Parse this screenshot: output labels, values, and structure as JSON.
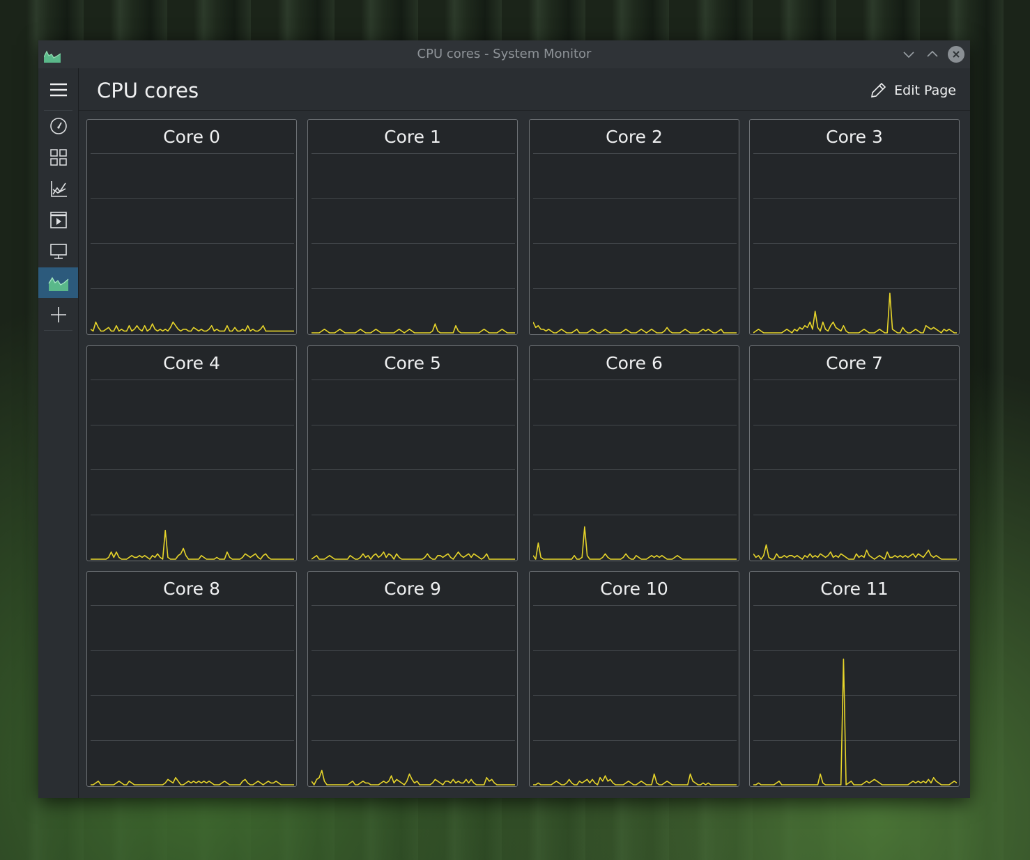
{
  "window": {
    "title": "CPU cores - System Monitor",
    "app_icon": "system-monitor-icon"
  },
  "page": {
    "title": "CPU cores",
    "edit_label": "Edit Page"
  },
  "sidebar": {
    "items": [
      {
        "icon": "hamburger-menu-icon"
      },
      {
        "icon": "speedometer-icon"
      },
      {
        "icon": "applications-grid-icon"
      },
      {
        "icon": "history-chart-icon"
      },
      {
        "icon": "processes-icon"
      },
      {
        "icon": "display-icon"
      },
      {
        "icon": "cpu-cores-icon",
        "active": true
      },
      {
        "icon": "add-page-icon"
      }
    ]
  },
  "colors": {
    "accent": "#2c5a7c",
    "line": "#e7d52a",
    "card_bg": "#232629",
    "window_bg": "#2a2e32"
  },
  "chart_data": {
    "type": "line",
    "ylim": [
      0,
      100
    ],
    "grid": true,
    "series": [
      {
        "name": "Core 0",
        "values": [
          2,
          1,
          6,
          3,
          1,
          1,
          2,
          3,
          1,
          1,
          4,
          1,
          2,
          1,
          1,
          4,
          1,
          2,
          4,
          2,
          1,
          4,
          1,
          2,
          5,
          2,
          1,
          2,
          1,
          2,
          1,
          3,
          6,
          4,
          2,
          1,
          2,
          2,
          1,
          1,
          3,
          2,
          1,
          2,
          1,
          1,
          2,
          4,
          1,
          2,
          1,
          1,
          1,
          4,
          1,
          1,
          3,
          1,
          1,
          2,
          1,
          4,
          1,
          2,
          1,
          1,
          2,
          4,
          1,
          1,
          1,
          1,
          1,
          1,
          1,
          1,
          1,
          1,
          1,
          1
        ]
      },
      {
        "name": "Core 1",
        "values": [
          0,
          0,
          0,
          0,
          1,
          2,
          1,
          0,
          0,
          0,
          1,
          2,
          1,
          0,
          0,
          0,
          0,
          0,
          1,
          2,
          1,
          0,
          0,
          0,
          1,
          2,
          1,
          0,
          0,
          0,
          0,
          0,
          0,
          1,
          2,
          1,
          0,
          1,
          2,
          1,
          0,
          0,
          0,
          0,
          0,
          0,
          0,
          1,
          5,
          1,
          0,
          0,
          0,
          0,
          0,
          0,
          4,
          1,
          0,
          0,
          0,
          0,
          0,
          0,
          0,
          0,
          1,
          2,
          1,
          0,
          0,
          0,
          0,
          1,
          2,
          1,
          0,
          0,
          0,
          0
        ]
      },
      {
        "name": "Core 2",
        "values": [
          6,
          3,
          4,
          2,
          2,
          1,
          2,
          1,
          0,
          0,
          1,
          2,
          1,
          0,
          0,
          0,
          1,
          2,
          0,
          0,
          0,
          0,
          1,
          2,
          1,
          0,
          0,
          1,
          2,
          1,
          0,
          0,
          0,
          0,
          0,
          1,
          2,
          1,
          0,
          0,
          0,
          1,
          2,
          1,
          0,
          1,
          2,
          1,
          0,
          0,
          0,
          1,
          3,
          1,
          0,
          0,
          0,
          0,
          1,
          2,
          1,
          0,
          0,
          0,
          0,
          1,
          2,
          1,
          2,
          1,
          0,
          0,
          1,
          2,
          0,
          0,
          0,
          0,
          0,
          0
        ]
      },
      {
        "name": "Core 3",
        "values": [
          0,
          1,
          2,
          1,
          0,
          0,
          0,
          0,
          0,
          0,
          0,
          0,
          1,
          2,
          1,
          0,
          2,
          1,
          3,
          2,
          4,
          3,
          6,
          2,
          12,
          3,
          1,
          6,
          2,
          1,
          4,
          6,
          3,
          2,
          1,
          4,
          1,
          0,
          0,
          0,
          0,
          0,
          1,
          2,
          1,
          0,
          0,
          0,
          1,
          2,
          1,
          0,
          0,
          22,
          2,
          1,
          0,
          0,
          3,
          1,
          0,
          0,
          1,
          2,
          1,
          0,
          0,
          4,
          3,
          2,
          3,
          2,
          1,
          0,
          2,
          1,
          2,
          1,
          0,
          0
        ]
      },
      {
        "name": "Core 4",
        "values": [
          0,
          0,
          0,
          0,
          0,
          0,
          0,
          1,
          4,
          1,
          4,
          1,
          0,
          0,
          0,
          1,
          2,
          1,
          1,
          2,
          1,
          2,
          1,
          0,
          2,
          1,
          3,
          1,
          0,
          16,
          1,
          0,
          0,
          0,
          2,
          3,
          6,
          2,
          0,
          0,
          0,
          0,
          0,
          2,
          1,
          0,
          0,
          0,
          0,
          1,
          0,
          0,
          0,
          4,
          1,
          0,
          0,
          0,
          0,
          1,
          3,
          2,
          1,
          2,
          3,
          1,
          0,
          2,
          3,
          1,
          0,
          0,
          0,
          0,
          0,
          0,
          0,
          0,
          0,
          0
        ]
      },
      {
        "name": "Core 5",
        "values": [
          0,
          1,
          2,
          0,
          0,
          0,
          1,
          2,
          1,
          0,
          0,
          0,
          0,
          0,
          0,
          2,
          1,
          0,
          0,
          1,
          3,
          1,
          2,
          0,
          2,
          3,
          1,
          2,
          4,
          1,
          3,
          2,
          0,
          3,
          1,
          0,
          0,
          0,
          0,
          0,
          0,
          0,
          0,
          0,
          1,
          3,
          1,
          0,
          0,
          2,
          2,
          1,
          2,
          3,
          1,
          0,
          2,
          4,
          2,
          1,
          2,
          3,
          1,
          3,
          2,
          1,
          0,
          1,
          3,
          0,
          0,
          0,
          0,
          0,
          0,
          0,
          0,
          0,
          0,
          0
        ]
      },
      {
        "name": "Core 6",
        "values": [
          2,
          0,
          9,
          1,
          0,
          0,
          0,
          0,
          0,
          0,
          0,
          0,
          0,
          0,
          0,
          0,
          2,
          0,
          0,
          1,
          18,
          2,
          0,
          0,
          0,
          0,
          0,
          1,
          3,
          1,
          0,
          0,
          0,
          0,
          0,
          1,
          3,
          1,
          0,
          0,
          2,
          1,
          0,
          0,
          0,
          1,
          2,
          1,
          2,
          1,
          2,
          1,
          0,
          0,
          0,
          1,
          2,
          1,
          0,
          0,
          0,
          0,
          0,
          0,
          0,
          0,
          0,
          0,
          0,
          0,
          0,
          0,
          0,
          0,
          0,
          0,
          0,
          0,
          0,
          0
        ]
      },
      {
        "name": "Core 7",
        "values": [
          3,
          1,
          2,
          0,
          2,
          8,
          1,
          0,
          0,
          3,
          1,
          1,
          2,
          1,
          2,
          2,
          1,
          2,
          1,
          0,
          2,
          1,
          3,
          1,
          2,
          1,
          3,
          2,
          1,
          2,
          4,
          1,
          2,
          1,
          3,
          2,
          1,
          0,
          0,
          0,
          3,
          1,
          2,
          1,
          5,
          2,
          1,
          0,
          1,
          2,
          1,
          0,
          4,
          1,
          1,
          2,
          1,
          2,
          1,
          2,
          1,
          2,
          3,
          1,
          3,
          2,
          1,
          3,
          5,
          2,
          1,
          2,
          1,
          0,
          0,
          0,
          0,
          0,
          0,
          0
        ]
      },
      {
        "name": "Core 8",
        "values": [
          0,
          0,
          1,
          2,
          0,
          0,
          0,
          0,
          0,
          0,
          1,
          2,
          1,
          0,
          0,
          2,
          1,
          0,
          0,
          0,
          0,
          0,
          0,
          0,
          0,
          0,
          0,
          0,
          0,
          1,
          3,
          2,
          1,
          4,
          2,
          0,
          0,
          1,
          2,
          1,
          2,
          1,
          2,
          1,
          2,
          1,
          2,
          1,
          0,
          0,
          0,
          1,
          2,
          1,
          0,
          0,
          0,
          0,
          0,
          2,
          3,
          1,
          0,
          0,
          1,
          2,
          1,
          0,
          1,
          2,
          1,
          1,
          2,
          1,
          0,
          0,
          0,
          0,
          0,
          0
        ]
      },
      {
        "name": "Core 9",
        "values": [
          2,
          0,
          3,
          4,
          8,
          2,
          0,
          0,
          0,
          0,
          0,
          0,
          0,
          0,
          0,
          1,
          2,
          0,
          0,
          1,
          2,
          1,
          1,
          0,
          0,
          0,
          0,
          1,
          2,
          1,
          2,
          5,
          1,
          3,
          2,
          1,
          0,
          2,
          6,
          3,
          1,
          2,
          0,
          0,
          0,
          0,
          0,
          1,
          3,
          2,
          1,
          0,
          2,
          2,
          1,
          3,
          1,
          2,
          1,
          1,
          3,
          1,
          3,
          1,
          0,
          0,
          0,
          0,
          4,
          2,
          3,
          1,
          0,
          0,
          0,
          0,
          0,
          0,
          0,
          0
        ]
      },
      {
        "name": "Core 10",
        "values": [
          0,
          0,
          1,
          0,
          0,
          0,
          0,
          0,
          1,
          2,
          1,
          0,
          0,
          1,
          3,
          1,
          0,
          0,
          2,
          1,
          2,
          3,
          1,
          3,
          1,
          0,
          4,
          2,
          5,
          2,
          3,
          1,
          0,
          0,
          0,
          0,
          1,
          2,
          1,
          0,
          0,
          1,
          2,
          1,
          0,
          0,
          0,
          6,
          1,
          0,
          0,
          1,
          2,
          1,
          0,
          0,
          0,
          0,
          0,
          0,
          0,
          6,
          2,
          1,
          0,
          0,
          1,
          0,
          1,
          0,
          0,
          0,
          0,
          0,
          0,
          0,
          0,
          0,
          0,
          0
        ]
      },
      {
        "name": "Core 11",
        "values": [
          0,
          0,
          1,
          0,
          0,
          0,
          0,
          0,
          0,
          1,
          2,
          0,
          0,
          0,
          0,
          0,
          0,
          0,
          0,
          0,
          0,
          0,
          0,
          0,
          0,
          0,
          6,
          1,
          0,
          0,
          0,
          0,
          0,
          0,
          0,
          70,
          0,
          1,
          2,
          0,
          0,
          0,
          0,
          1,
          2,
          1,
          2,
          3,
          2,
          1,
          0,
          0,
          0,
          0,
          0,
          0,
          0,
          0,
          0,
          0,
          0,
          1,
          2,
          1,
          2,
          1,
          2,
          1,
          3,
          1,
          4,
          2,
          1,
          0,
          0,
          0,
          0,
          1,
          2,
          1
        ]
      }
    ]
  }
}
